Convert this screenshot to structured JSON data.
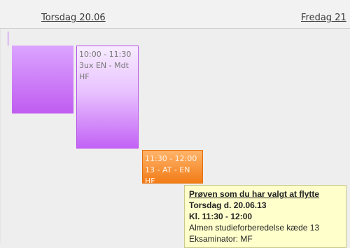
{
  "header": {
    "days": [
      {
        "label": "Torsdag 20.06"
      },
      {
        "label": "Fredag 21"
      }
    ]
  },
  "events": [
    {
      "lines": []
    },
    {
      "lines": [
        "10:00 - 11:30",
        "3ux EN - Mdt",
        "HF"
      ]
    },
    {
      "lines": [
        "11:30 - 12:00",
        "13 - AT - EN",
        "HF"
      ]
    }
  ],
  "tooltip": {
    "title": "Prøven som du har valgt at flytte",
    "date": "Torsdag d. 20.06.13",
    "time": "Kl. 11:30 - 12:00",
    "subject": "Almen studieforberedelse kæde 13",
    "examiner": "Eksaminator: MF"
  },
  "colors": {
    "purple": "#c05cf0",
    "light_purple": "#e8c2ff",
    "orange": "#f27c17",
    "tooltip_bg": "#ffffcc"
  }
}
